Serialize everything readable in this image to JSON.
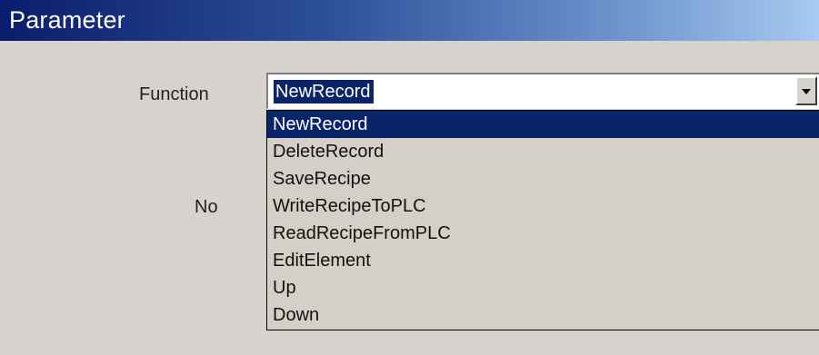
{
  "window": {
    "title": "Parameter"
  },
  "form": {
    "function_label": "Function",
    "no_label": "No"
  },
  "function_combo": {
    "selected_value": "NewRecord",
    "icon": "chevron-down-icon",
    "options": [
      "NewRecord",
      "DeleteRecord",
      "SaveRecipe",
      "WriteRecipeToPLC",
      "ReadRecipeFromPLC",
      "EditElement",
      "Up",
      "Down"
    ],
    "highlighted_index": 0
  },
  "colors": {
    "titlebar_start": "#0a1d6c",
    "titlebar_end": "#a6caf0",
    "selection": "#0a246a",
    "background": "#d6d3ce"
  }
}
